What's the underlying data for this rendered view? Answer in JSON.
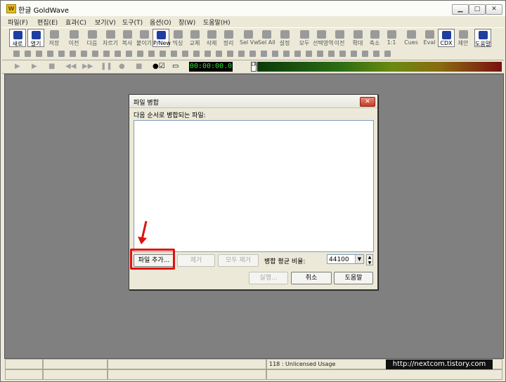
{
  "app": {
    "title": "한글 GoldWave"
  },
  "menu": [
    "파일(F)",
    "편집(E)",
    "효과(C)",
    "보기(V)",
    "도구(T)",
    "옵션(O)",
    "창(W)",
    "도움말(H)"
  ],
  "toolbar": [
    "새로",
    "열기",
    "저장",
    "이전",
    "다음",
    "자르기",
    "복사",
    "붙이기",
    "P/New",
    "믹싱",
    "교체",
    "삭제",
    "정리",
    "Sel Vw",
    "Sel All",
    "설정",
    "모두",
    "선택영역",
    "이전",
    "확대",
    "축소",
    "1:1",
    "Cues",
    "Eval",
    "CDX",
    "제안",
    "도움말"
  ],
  "transport": {
    "counter": "00:00:00.0",
    "lr_label": "LR"
  },
  "dialog": {
    "title": "파일 병합",
    "list_label": "다음 순서로 병합되는 파일:",
    "add_file_btn": "파일 추가...",
    "remove_btn": "제거",
    "remove_all_btn": "모두 제거",
    "rate_label": "병합 평균 비율:",
    "rate_value": "44100",
    "run_btn": "실행...",
    "cancel_btn": "취소",
    "help_btn": "도움말"
  },
  "status": {
    "usage": "118 : Unlicensed Usage"
  },
  "watermark": "http://nextcom.tistory.com",
  "colors": {
    "highlight": "#e01010",
    "workspace": "#808080",
    "counter_text": "#28e028"
  }
}
